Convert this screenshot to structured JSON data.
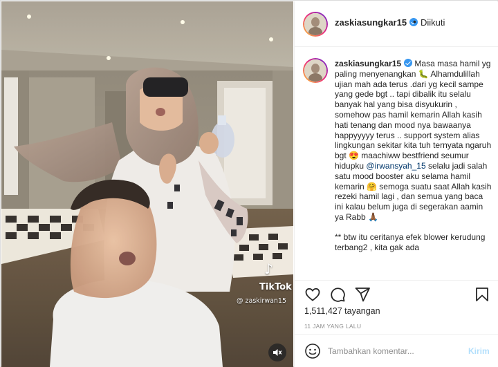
{
  "post": {
    "username": "zaskiasungkar15",
    "verified": true,
    "follow_separator": "•",
    "follow_status": "Diikuti",
    "views": "1,511,427 tayangan",
    "time_ago": "11 JAM YANG LALU"
  },
  "caption": {
    "line1_text": "Masa masa hamil yg paling menyenangkan 🐛 Alhamdulillah ujian mah ada terus .dari yg kecil sampe yang gede bgt .. tapi dibalik itu selalu banyak hal yang bisa disyukurin , somehow pas hamil kemarin Allah kasih hati tenang dan mood nya bawaanya happyyyyy terus .. support system alias lingkungan sekitar kita tuh ternyata ngaruh bgt 😍 maachiww bestfriend seumur hidupku",
    "mention": "@irwansyah_15",
    "line2_text": "selalu jadi salah satu mood booster aku selama hamil kemarin 🤗 semoga suatu saat Allah kasih rezeki hamil lagi , dan semua yang baca ini kalau belum juga di segerakan aamin ya Rabb 🙏🏾",
    "line3_text": "** btw itu ceritanya efek blower kerudung terbang2 , kita gak ada"
  },
  "video": {
    "watermark_brand": "TikTok",
    "watermark_user": "@ zaskirwan15"
  },
  "comment": {
    "placeholder": "Tambahkan komentar...",
    "post_label": "Kirim"
  },
  "icons": {
    "like": "heart-icon",
    "comment": "comment-icon",
    "share": "share-icon",
    "save": "bookmark-icon",
    "emoji": "smile-icon",
    "sound": "speaker-muted-icon",
    "watermark": "tiktok-note-icon"
  },
  "colors": {
    "text": "#262626",
    "muted": "#8e8e8e",
    "link": "#00376b",
    "verified": "#3897f0",
    "post_disabled": "#b2dffc",
    "border": "#dbdbdb"
  }
}
